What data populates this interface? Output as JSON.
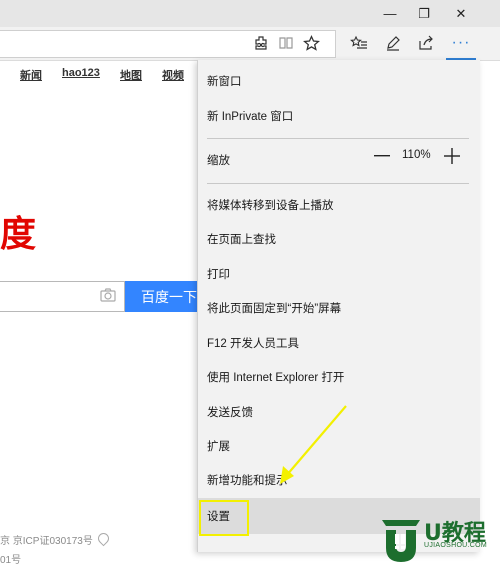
{
  "window": {
    "minimize_glyph": "—",
    "restore_glyph": "❐",
    "close_glyph": "✕"
  },
  "toolbar": {
    "more_glyph": "···",
    "icons": [
      "extension-puzzle-icon",
      "reading-view-icon",
      "favorite-star-icon",
      "favorites-hub-icon",
      "web-note-pen-icon",
      "share-icon"
    ],
    "accent": "#2f7fd4"
  },
  "page": {
    "nav": [
      "新闻",
      "hao123",
      "地图",
      "视频"
    ],
    "logo_fragment": "度",
    "search_button": "百度一下",
    "footer_line1": "京 京ICP证030173号",
    "footer_line2": "01号",
    "brand_red": "#e10602",
    "brand_blue": "#3385ff"
  },
  "menu": {
    "new_window": "新窗口",
    "new_inprivate": "新 InPrivate 窗口",
    "zoom_label": "缩放",
    "zoom_value": "110%",
    "cast": "将媒体转移到设备上播放",
    "find": "在页面上查找",
    "print": "打印",
    "pin_start": "将此页面固定到“开始”屏幕",
    "f12": "F12 开发人员工具",
    "open_ie": "使用 Internet Explorer 打开",
    "feedback": "发送反馈",
    "extensions": "扩展",
    "whats_new": "新增功能和提示",
    "settings": "设置"
  },
  "annotation": {
    "color": "#f3f000"
  },
  "watermark": {
    "title": "U教程",
    "subtitle": "UJIAOSHOU.COM"
  }
}
